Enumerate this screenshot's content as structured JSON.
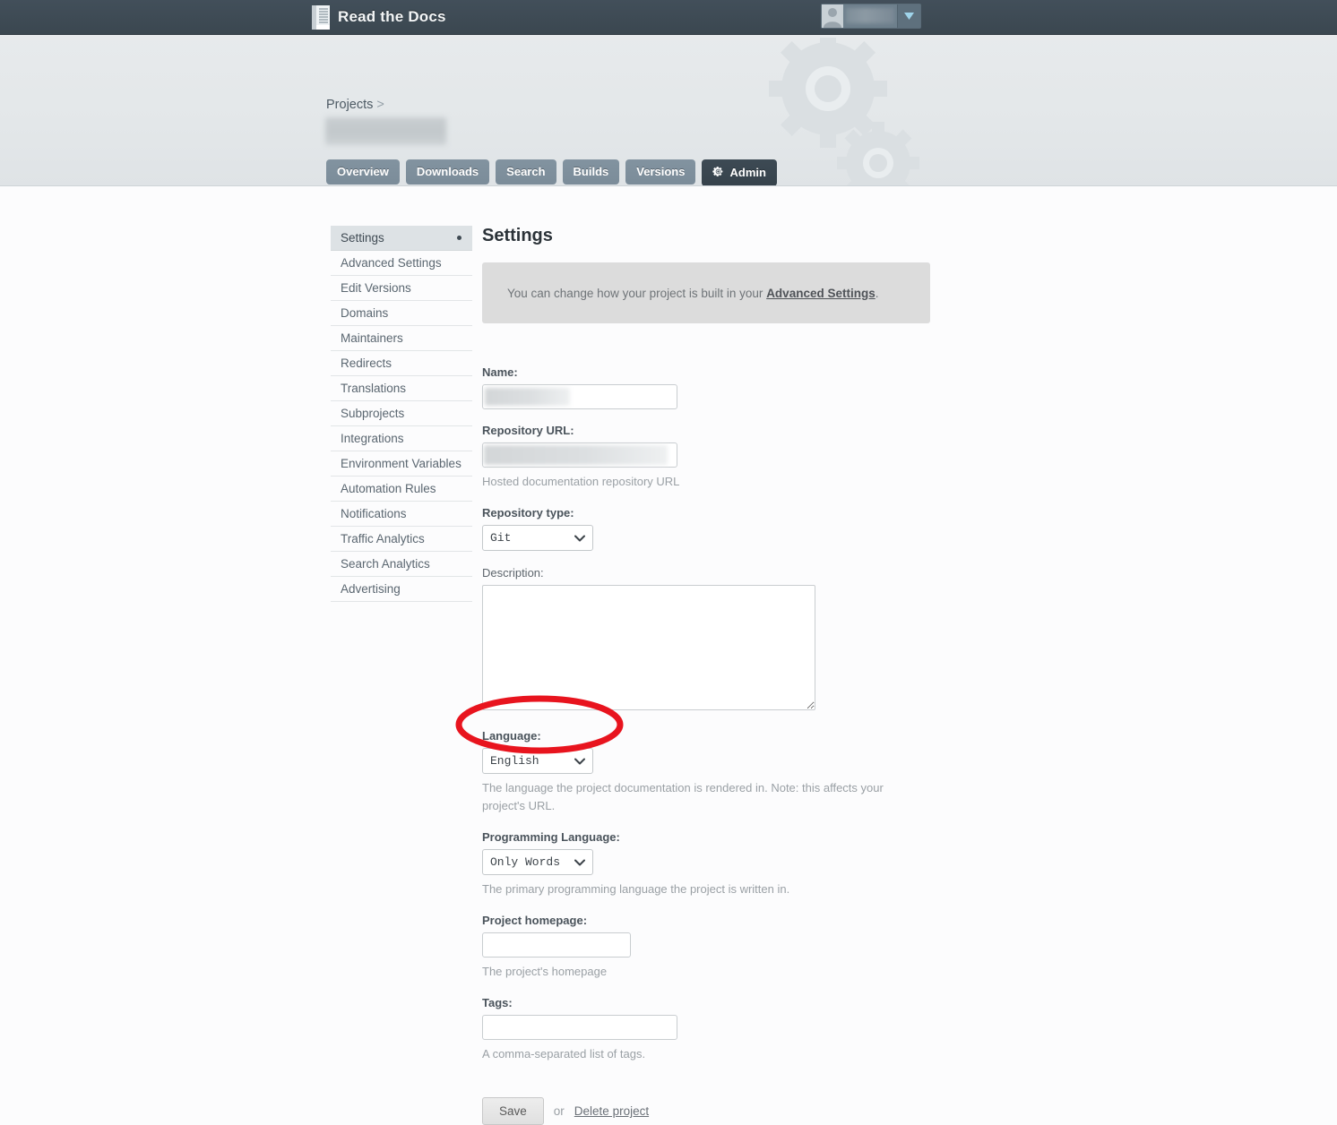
{
  "topbar": {
    "brand": "Read the Docs",
    "logo_icon": "book-icon",
    "user_avatar_icon": "user-avatar-icon",
    "user_name": "",
    "caret_icon": "chevron-down-icon"
  },
  "project_header": {
    "breadcrumb_root": "Projects",
    "breadcrumb_separator": ">",
    "project_name": "",
    "gear_decoration_icon": "gears-decoration-icon",
    "tabs": [
      {
        "label": "Overview",
        "active": false
      },
      {
        "label": "Downloads",
        "active": false
      },
      {
        "label": "Search",
        "active": false
      },
      {
        "label": "Builds",
        "active": false
      },
      {
        "label": "Versions",
        "active": false
      },
      {
        "label": "Admin",
        "active": true,
        "icon": "gear-icon"
      }
    ]
  },
  "sidebar": {
    "items": [
      {
        "label": "Settings",
        "active": true
      },
      {
        "label": "Advanced Settings",
        "active": false
      },
      {
        "label": "Edit Versions",
        "active": false
      },
      {
        "label": "Domains",
        "active": false
      },
      {
        "label": "Maintainers",
        "active": false
      },
      {
        "label": "Redirects",
        "active": false
      },
      {
        "label": "Translations",
        "active": false
      },
      {
        "label": "Subprojects",
        "active": false
      },
      {
        "label": "Integrations",
        "active": false
      },
      {
        "label": "Environment Variables",
        "active": false
      },
      {
        "label": "Automation Rules",
        "active": false
      },
      {
        "label": "Notifications",
        "active": false
      },
      {
        "label": "Traffic Analytics",
        "active": false
      },
      {
        "label": "Search Analytics",
        "active": false
      },
      {
        "label": "Advertising",
        "active": false
      }
    ]
  },
  "main": {
    "title": "Settings",
    "notice": {
      "text_before": "You can change how your project is built in your ",
      "link": "Advanced Settings",
      "text_after": "."
    },
    "form": {
      "name": {
        "label": "Name:",
        "value": "",
        "redacted": true
      },
      "repository_url": {
        "label": "Repository URL:",
        "value": "",
        "redacted": true,
        "help": "Hosted documentation repository URL"
      },
      "repository_type": {
        "label": "Repository type:",
        "value": "Git",
        "options": [
          "Git"
        ]
      },
      "description": {
        "label": "Description:",
        "value": ""
      },
      "language": {
        "label": "Language:",
        "value": "English",
        "options": [
          "English"
        ],
        "help": "The language the project documentation is rendered in. Note: this affects your project's URL."
      },
      "programming_language": {
        "label": "Programming Language:",
        "value": "Only Words",
        "options": [
          "Only Words"
        ],
        "help": "The primary programming language the project is written in."
      },
      "project_homepage": {
        "label": "Project homepage:",
        "value": "",
        "help": "The project's homepage"
      },
      "tags": {
        "label": "Tags:",
        "value": "",
        "help": "A comma-separated list of tags."
      }
    },
    "actions": {
      "save_label": "Save",
      "or_label": "or",
      "delete_label": "Delete project"
    }
  },
  "annotation": {
    "shape": "ellipse",
    "color": "#e8141e",
    "target": "Language select"
  },
  "colors": {
    "topbar_bg": "#3d4a54",
    "header_band_bg": "#e4e8ea",
    "tab_bg": "#7e8f9c",
    "tab_active_bg": "#3a4650",
    "page_bg": "#fcfcfd",
    "notice_bg": "#dcdcdc",
    "sidebar_active_bg": "#dde2e5",
    "annotation_red": "#e8141e"
  }
}
